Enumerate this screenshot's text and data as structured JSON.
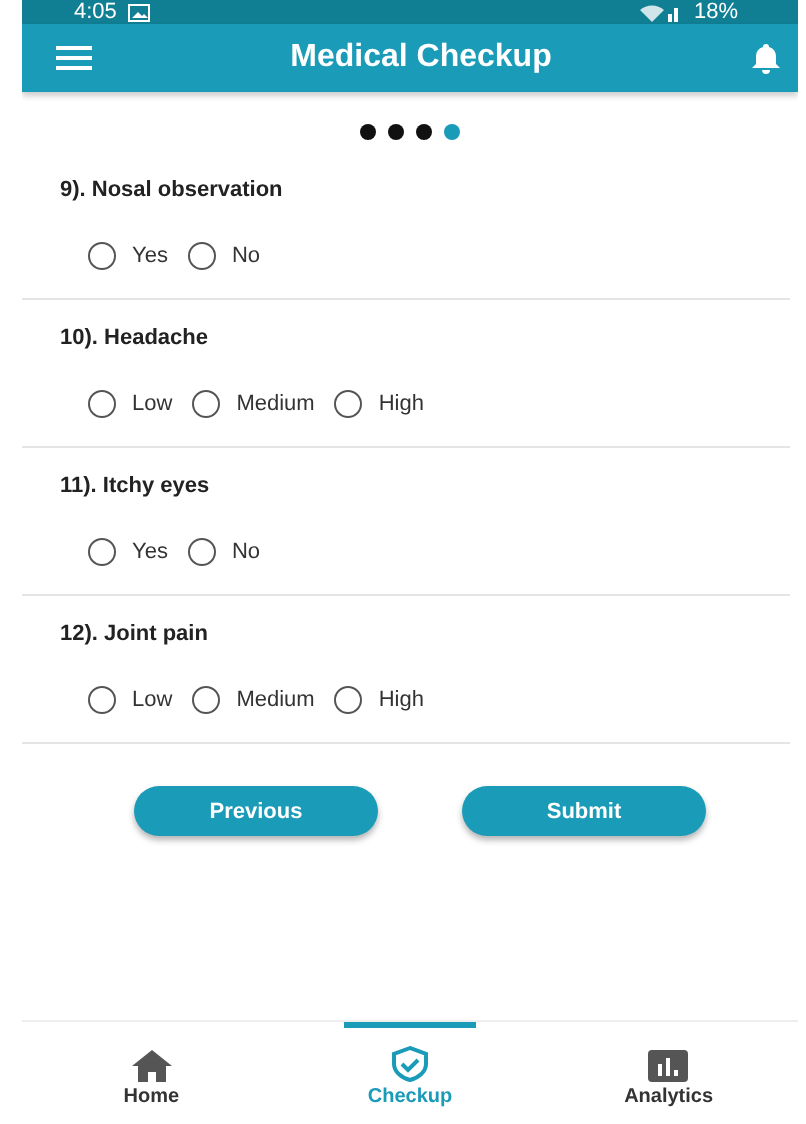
{
  "status_bar": {
    "time": "4:05",
    "battery": "18%"
  },
  "app_bar": {
    "title": "Medical Checkup"
  },
  "pager": [
    {
      "selected": false
    },
    {
      "selected": false
    },
    {
      "selected": false
    },
    {
      "selected": true
    }
  ],
  "questions": [
    {
      "label": "9). Nosal observation",
      "options": [
        {
          "label": "Yes",
          "selected": false
        },
        {
          "label": "No",
          "selected": false
        }
      ]
    },
    {
      "label": "10). Headache",
      "options": [
        {
          "label": "Low",
          "selected": false
        },
        {
          "label": "Medium",
          "selected": false
        },
        {
          "label": "High",
          "selected": false
        }
      ]
    },
    {
      "label": "11). Itchy eyes",
      "options": [
        {
          "label": "Yes",
          "selected": false
        },
        {
          "label": "No",
          "selected": false
        }
      ]
    },
    {
      "label": "12). Joint pain",
      "options": [
        {
          "label": "Low",
          "selected": false
        },
        {
          "label": "Medium",
          "selected": false
        },
        {
          "label": "High",
          "selected": false
        }
      ]
    }
  ],
  "buttons": [
    "Previous",
    "Submit"
  ],
  "bottom_nav": [
    {
      "kind": "home",
      "label": "Home",
      "selected": false
    },
    {
      "kind": "checkup",
      "label": "Checkup",
      "selected": true
    },
    {
      "kind": "analytics",
      "label": "Analytics",
      "selected": false
    }
  ]
}
